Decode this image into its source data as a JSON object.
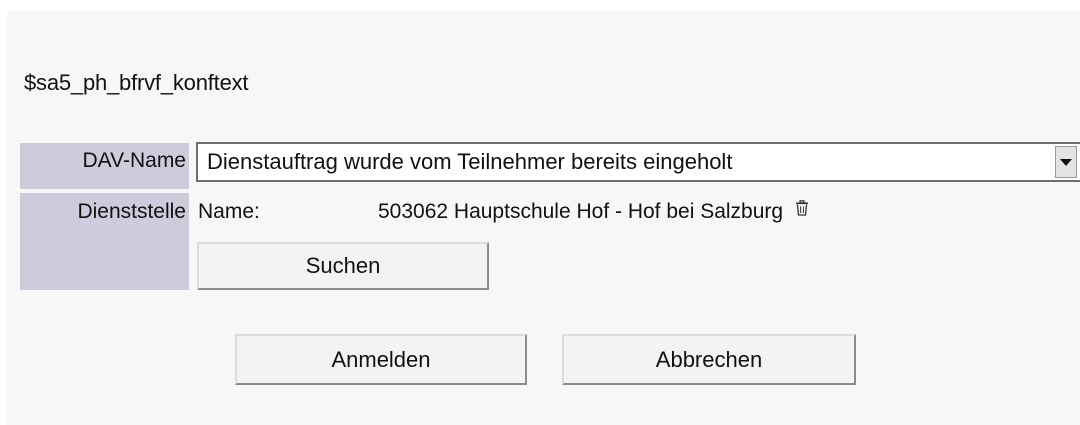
{
  "form": {
    "context_text": "$sa5_ph_bfrvf_konftext",
    "dav_name": {
      "label": "DAV-Name",
      "selected_value": "Dienstauftrag wurde vom Teilnehmer bereits eingeholt"
    },
    "dienststelle": {
      "label": "Dienststelle",
      "name_label": "Name:",
      "name_value": "503062 Hauptschule Hof - Hof bei Salzburg",
      "search_button": "Suchen"
    },
    "actions": {
      "login_button": "Anmelden",
      "cancel_button": "Abbrechen"
    }
  },
  "icons": {
    "delete": "trash-icon",
    "dropdown": "chevron-down-icon"
  },
  "colors": {
    "label_background": "#ccccdd",
    "panel_background": "#f7f7f7"
  }
}
